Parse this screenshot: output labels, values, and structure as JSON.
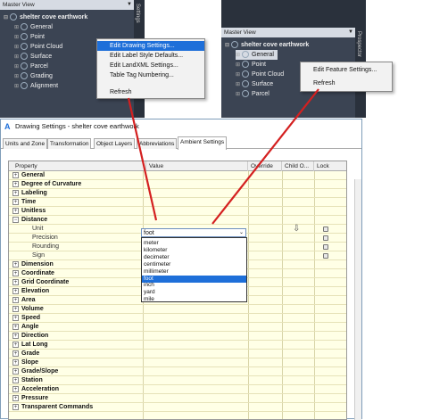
{
  "left_panel": {
    "master_view": "Master View",
    "sidebar_label": "Settings",
    "tree": [
      {
        "label": "shelter cove earthwork",
        "root": true
      },
      {
        "label": "General"
      },
      {
        "label": "Point"
      },
      {
        "label": "Point Cloud"
      },
      {
        "label": "Surface"
      },
      {
        "label": "Parcel"
      },
      {
        "label": "Grading"
      },
      {
        "label": "Alignment"
      }
    ]
  },
  "left_menu": {
    "items": [
      {
        "label": "Edit Drawing Settings...",
        "highlight": true
      },
      {
        "label": "Edit Label Style Defaults..."
      },
      {
        "label": "Edit LandXML Settings..."
      },
      {
        "label": "Table Tag Numbering..."
      },
      {
        "label": "Refresh"
      }
    ]
  },
  "right_panel": {
    "master_view": "Master View",
    "sidebar_label": "Prospector",
    "tree": [
      {
        "label": "shelter cove earthwork",
        "root": true
      },
      {
        "label": "General",
        "selected": true
      },
      {
        "label": "Point"
      },
      {
        "label": "Point Cloud"
      },
      {
        "label": "Surface"
      },
      {
        "label": "Parcel"
      }
    ]
  },
  "right_menu": {
    "items": [
      {
        "label": "Edit Feature Settings..."
      },
      {
        "label": "Refresh"
      }
    ]
  },
  "dialog": {
    "title": "Drawing Settings - shelter cove earthwork",
    "tabs": [
      "Units and Zone",
      "Transformation",
      "Object Layers",
      "Abbreviations",
      "Ambient Settings"
    ],
    "active_tab": "Ambient Settings",
    "columns": [
      "Property",
      "Value",
      "Override",
      "Child O...",
      "Lock"
    ],
    "rows": [
      {
        "label": "General",
        "type": "cat"
      },
      {
        "label": "Degree of Curvature",
        "type": "cat"
      },
      {
        "label": "Labeling",
        "type": "cat"
      },
      {
        "label": "Time",
        "type": "cat"
      },
      {
        "label": "Unitless",
        "type": "cat"
      },
      {
        "label": "Distance",
        "type": "cat",
        "expanded": true
      },
      {
        "label": "Unit",
        "type": "sub"
      },
      {
        "label": "Precision",
        "type": "sub"
      },
      {
        "label": "Rounding",
        "type": "sub"
      },
      {
        "label": "Sign",
        "type": "sub"
      },
      {
        "label": "Dimension",
        "type": "cat"
      },
      {
        "label": "Coordinate",
        "type": "cat"
      },
      {
        "label": "Grid Coordinate",
        "type": "cat"
      },
      {
        "label": "Elevation",
        "type": "cat"
      },
      {
        "label": "Area",
        "type": "cat"
      },
      {
        "label": "Volume",
        "type": "cat"
      },
      {
        "label": "Speed",
        "type": "cat"
      },
      {
        "label": "Angle",
        "type": "cat"
      },
      {
        "label": "Direction",
        "type": "cat"
      },
      {
        "label": "Lat Long",
        "type": "cat"
      },
      {
        "label": "Grade",
        "type": "cat"
      },
      {
        "label": "Slope",
        "type": "cat"
      },
      {
        "label": "Grade/Slope",
        "type": "cat"
      },
      {
        "label": "Station",
        "type": "cat"
      },
      {
        "label": "Acceleration",
        "type": "cat"
      },
      {
        "label": "Pressure",
        "type": "cat"
      },
      {
        "label": "Transparent Commands",
        "type": "cat"
      }
    ],
    "unit_value": "foot",
    "unit_options": [
      "meter",
      "kilometer",
      "decimeter",
      "centimeter",
      "millimeter",
      "foot",
      "inch",
      "yard",
      "mile"
    ],
    "unit_selected": "foot"
  },
  "colors": {
    "accent": "#1e6fd9",
    "annotation_arrow": "#d42020",
    "grid_bg": "#ffffe6",
    "panel_bg": "#3b4453"
  }
}
